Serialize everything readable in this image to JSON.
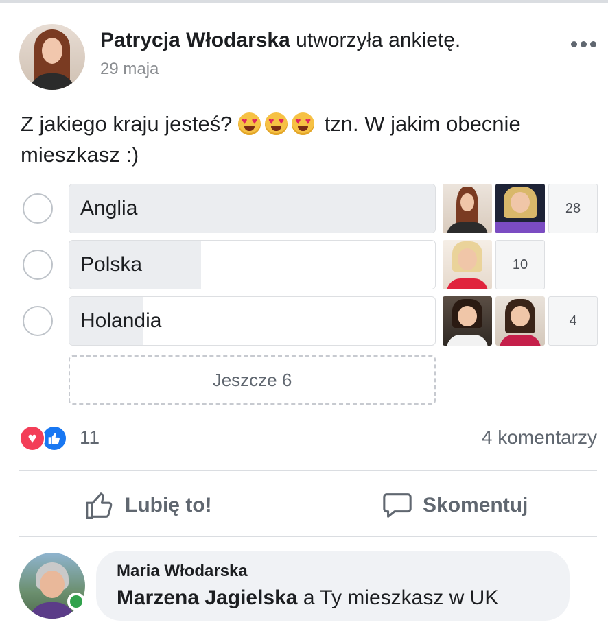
{
  "post": {
    "author": "Patrycja Włodarska",
    "action": "utworzyła ankietę.",
    "date": "29 maja",
    "text_before": "Z jakiego kraju jesteś?",
    "text_after": "tzn. W jakim obecnie mieszkasz :)",
    "emojis": [
      "heart-eyes-emoji",
      "heart-eyes-emoji",
      "heart-eyes-emoji"
    ]
  },
  "poll": {
    "options": [
      {
        "label": "Anglia",
        "votes": "28",
        "fill": 1.0
      },
      {
        "label": "Polska",
        "votes": "10",
        "fill": 0.36
      },
      {
        "label": "Holandia",
        "votes": "4",
        "fill": 0.2
      }
    ],
    "more_label": "Jeszcze 6"
  },
  "reactions": {
    "count": "11",
    "icons": [
      "love-icon",
      "like-icon"
    ]
  },
  "comments_count": "4 komentarzy",
  "actions": {
    "like": "Lubię to!",
    "comment": "Skomentuj"
  },
  "comment": {
    "author": "Maria Włodarska",
    "mention": "Marzena Jagielska",
    "text": " a Ty mieszkasz w UK"
  },
  "colors": {
    "like_blue": "#1877f2",
    "love_red": "#f33e58",
    "online_green": "#31a24c"
  }
}
